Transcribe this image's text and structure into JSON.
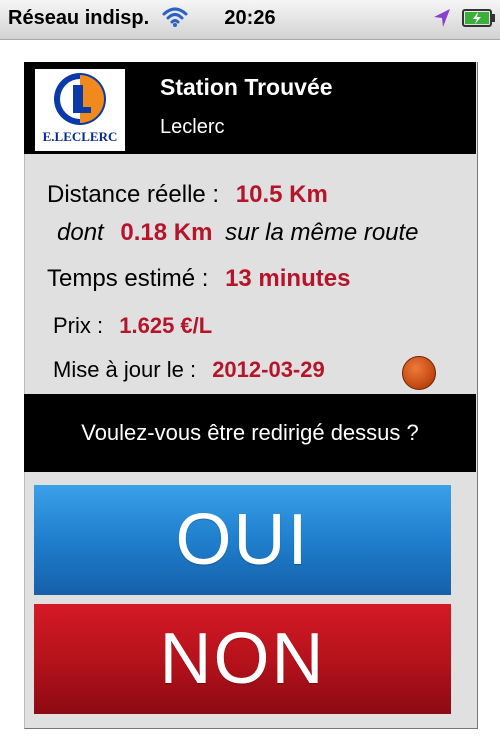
{
  "status_bar": {
    "carrier": "Réseau indisp.",
    "time": "20:26",
    "wifi_icon": "wifi-icon",
    "location_icon": "location-arrow-icon",
    "battery_icon": "battery-charging-icon"
  },
  "header": {
    "logo_text": "E.LECLERC",
    "title": "Station Trouvée",
    "subtitle": "Leclerc"
  },
  "details": {
    "distance_label": "Distance réelle :",
    "distance_value": "10.5 Km",
    "dont_label": "dont",
    "same_road_value": "0.18 Km",
    "same_road_label": "sur la même route",
    "time_label": "Temps estimé :",
    "time_value": "13 minutes",
    "price_label": "Prix :",
    "price_value": "1.625 €/L",
    "update_label": "Mise à jour le :",
    "update_value": "2012-03-29",
    "status_indicator_color": "#d5561a"
  },
  "question": "Voulez-vous être redirigé dessus ?",
  "buttons": {
    "yes": "OUI",
    "no": "NON"
  },
  "colors": {
    "value_red": "#b5152b",
    "yes_blue": "#1f7fce",
    "no_red": "#b6121c"
  }
}
